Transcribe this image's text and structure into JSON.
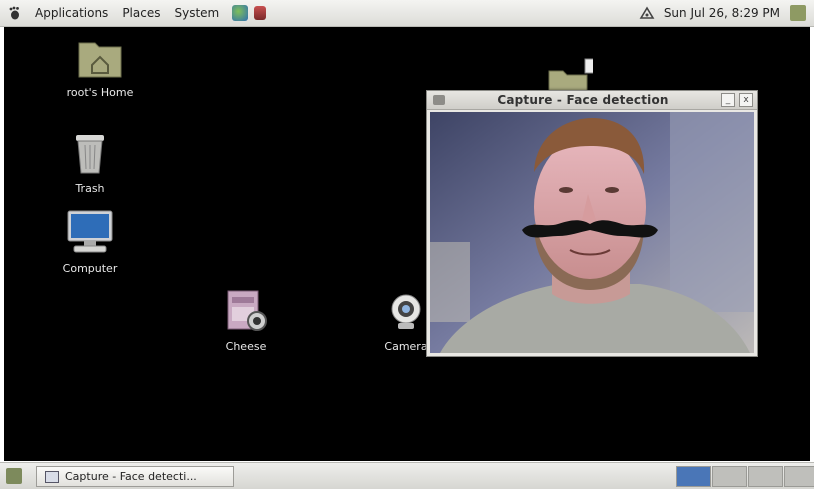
{
  "top_panel": {
    "menus": [
      "Applications",
      "Places",
      "System"
    ],
    "clock": "Sun Jul 26,  8:29 PM"
  },
  "desktop": {
    "icons": [
      {
        "label": "root's Home",
        "icon": "home-folder-icon"
      },
      {
        "label": "Trash",
        "icon": "trash-icon"
      },
      {
        "label": "Computer",
        "icon": "computer-icon"
      },
      {
        "label": "Cheese",
        "icon": "cheese-icon"
      },
      {
        "label": "Camera",
        "icon": "webcam-icon"
      },
      {
        "label": "",
        "icon": "folder-icon"
      }
    ]
  },
  "window": {
    "title": "Capture - Face detection",
    "minimize_glyph": "_",
    "close_glyph": "x"
  },
  "bottom_panel": {
    "task_label": "Capture - Face detecti..."
  },
  "colors": {
    "desktop_bg": "#000000",
    "panel_bg": "#dcdcd8",
    "active_workspace": "#4a76b7"
  }
}
